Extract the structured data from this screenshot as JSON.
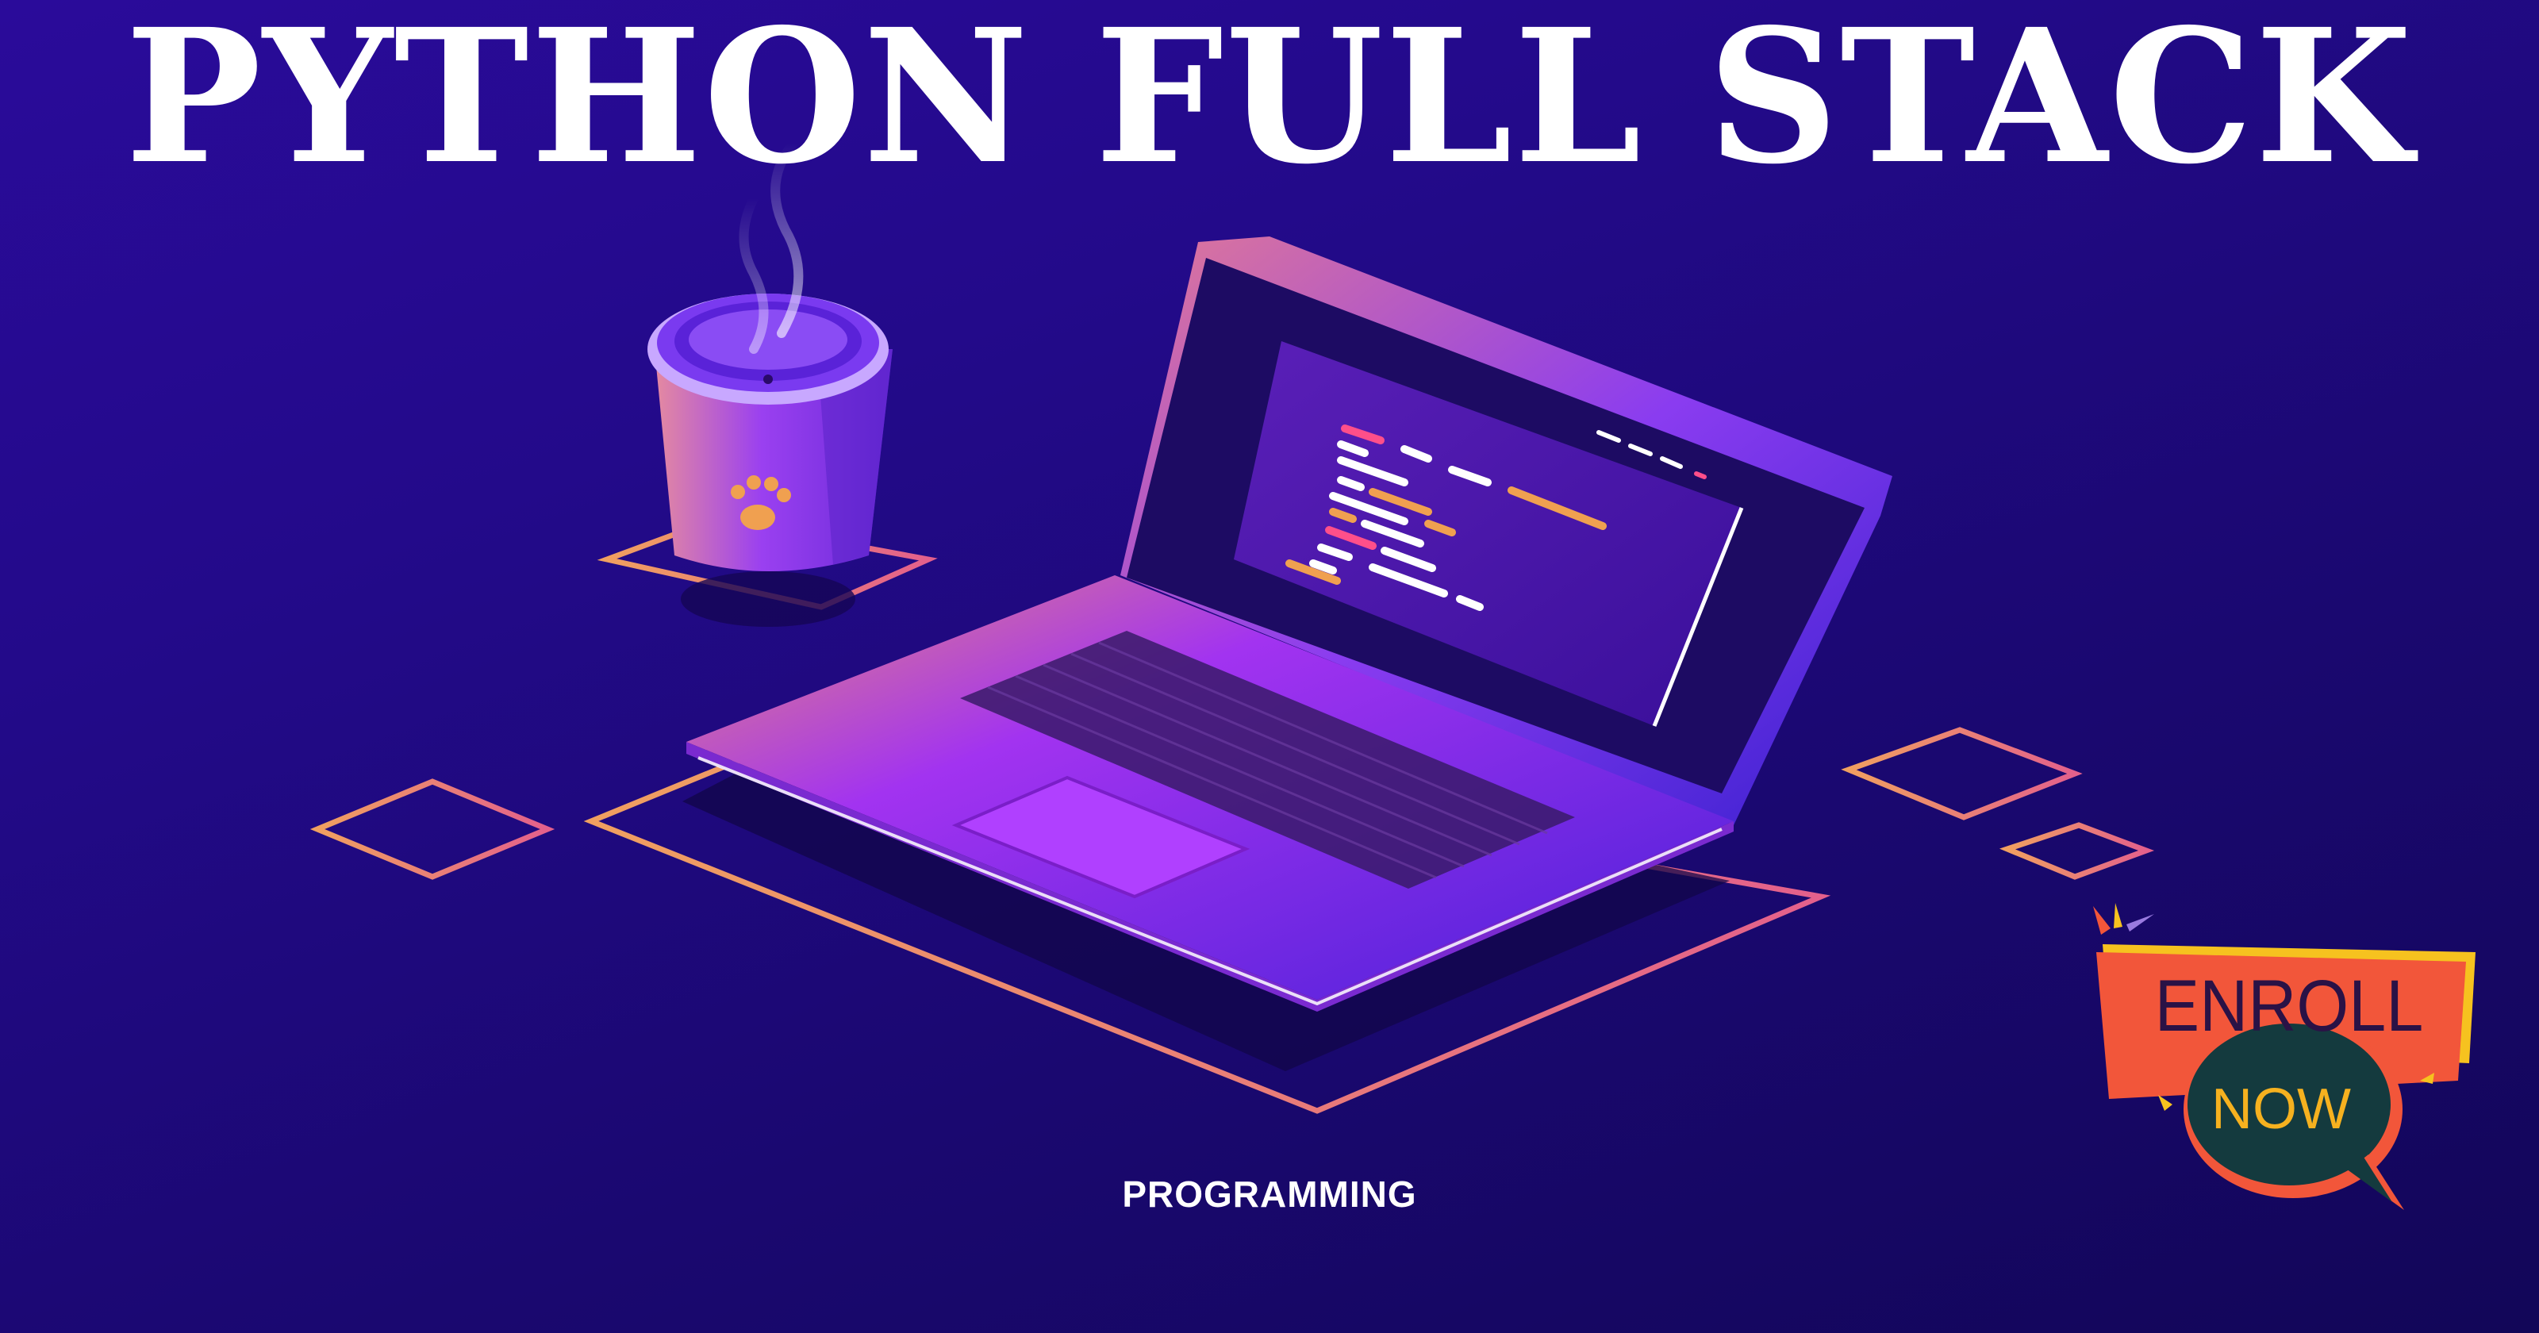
{
  "banner": {
    "title": "PYTHON FULL STACK",
    "caption": "PROGRAMMING",
    "cta": {
      "line1": "ENROLL",
      "line2": "NOW"
    }
  },
  "illustration": {
    "objects": [
      "laptop-icon",
      "coffee-cup-icon",
      "paw-print-icon",
      "steam-icon",
      "outline-diamond-icon"
    ]
  },
  "colors": {
    "background": "#1f0a7e",
    "accent_orange": "#f0a060",
    "accent_pink": "#e0608a",
    "laptop_purple": "#8a2be2",
    "cta_red": "#f2563a",
    "cta_yellow": "#f6c21f",
    "cta_dark": "#143a3e"
  }
}
